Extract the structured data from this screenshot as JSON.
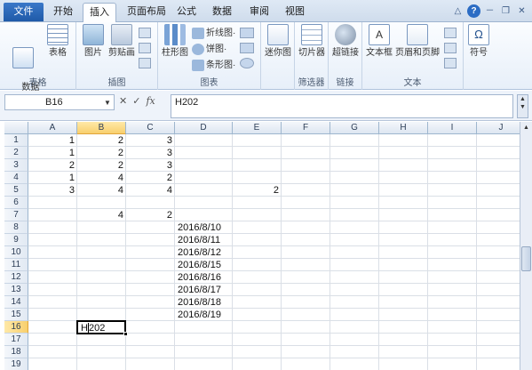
{
  "tabs": {
    "file": "文件",
    "items": [
      "开始",
      "插入",
      "页面布局",
      "公式",
      "数据",
      "审阅",
      "视图"
    ],
    "active": "插入"
  },
  "window_controls": [
    "△",
    "?",
    "－",
    "❐",
    "✕"
  ],
  "ribbon": {
    "groups": [
      {
        "label": "表格",
        "buttons": [
          "数据\n透视表·",
          "表格"
        ]
      },
      {
        "label": "插图",
        "buttons": [
          "图片",
          "剪贴画"
        ]
      },
      {
        "label": "图表",
        "buttons": [
          "柱形图",
          "折线图·",
          "饼图·",
          "条形图·"
        ]
      },
      {
        "label": "",
        "buttons": [
          "迷你图"
        ]
      },
      {
        "label": "筛选器",
        "buttons": [
          "切片器"
        ]
      },
      {
        "label": "链接",
        "buttons": [
          "超链接"
        ]
      },
      {
        "label": "文本",
        "buttons": [
          "文本框",
          "页眉和页脚"
        ]
      },
      {
        "label": "",
        "buttons": [
          "符号"
        ]
      }
    ]
  },
  "formula_bar": {
    "name_box": "B16",
    "formula": "H202",
    "icons": [
      "cancel-icon",
      "enter-icon",
      "fx-icon"
    ]
  },
  "columns": [
    "A",
    "B",
    "C",
    "D",
    "E",
    "F",
    "G",
    "H",
    "I",
    "J"
  ],
  "rows": [
    "1",
    "2",
    "3",
    "4",
    "5",
    "6",
    "7",
    "8",
    "9",
    "10",
    "11",
    "12",
    "13",
    "14",
    "15",
    "16",
    "17",
    "18",
    "19"
  ],
  "cells": {
    "A1": "1",
    "B1": "2",
    "C1": "3",
    "A2": "1",
    "B2": "2",
    "C2": "3",
    "A3": "2",
    "B3": "2",
    "C3": "3",
    "A4": "1",
    "B4": "4",
    "C4": "2",
    "A5": "3",
    "B5": "4",
    "C5": "4",
    "E5": "2",
    "B7": "4",
    "C7": "2",
    "D8": "2016/8/10",
    "D9": "2016/8/11",
    "D10": "2016/8/12",
    "D11": "2016/8/15",
    "D12": "2016/8/16",
    "D13": "2016/8/17",
    "D14": "2016/8/18",
    "D15": "2016/8/19"
  },
  "active_cell": {
    "ref": "B16",
    "value_before_caret": "H",
    "value_after_caret": "202"
  },
  "colors": {
    "file_tab": "#2a6bbf",
    "selection_header": "#f8cf6d"
  }
}
